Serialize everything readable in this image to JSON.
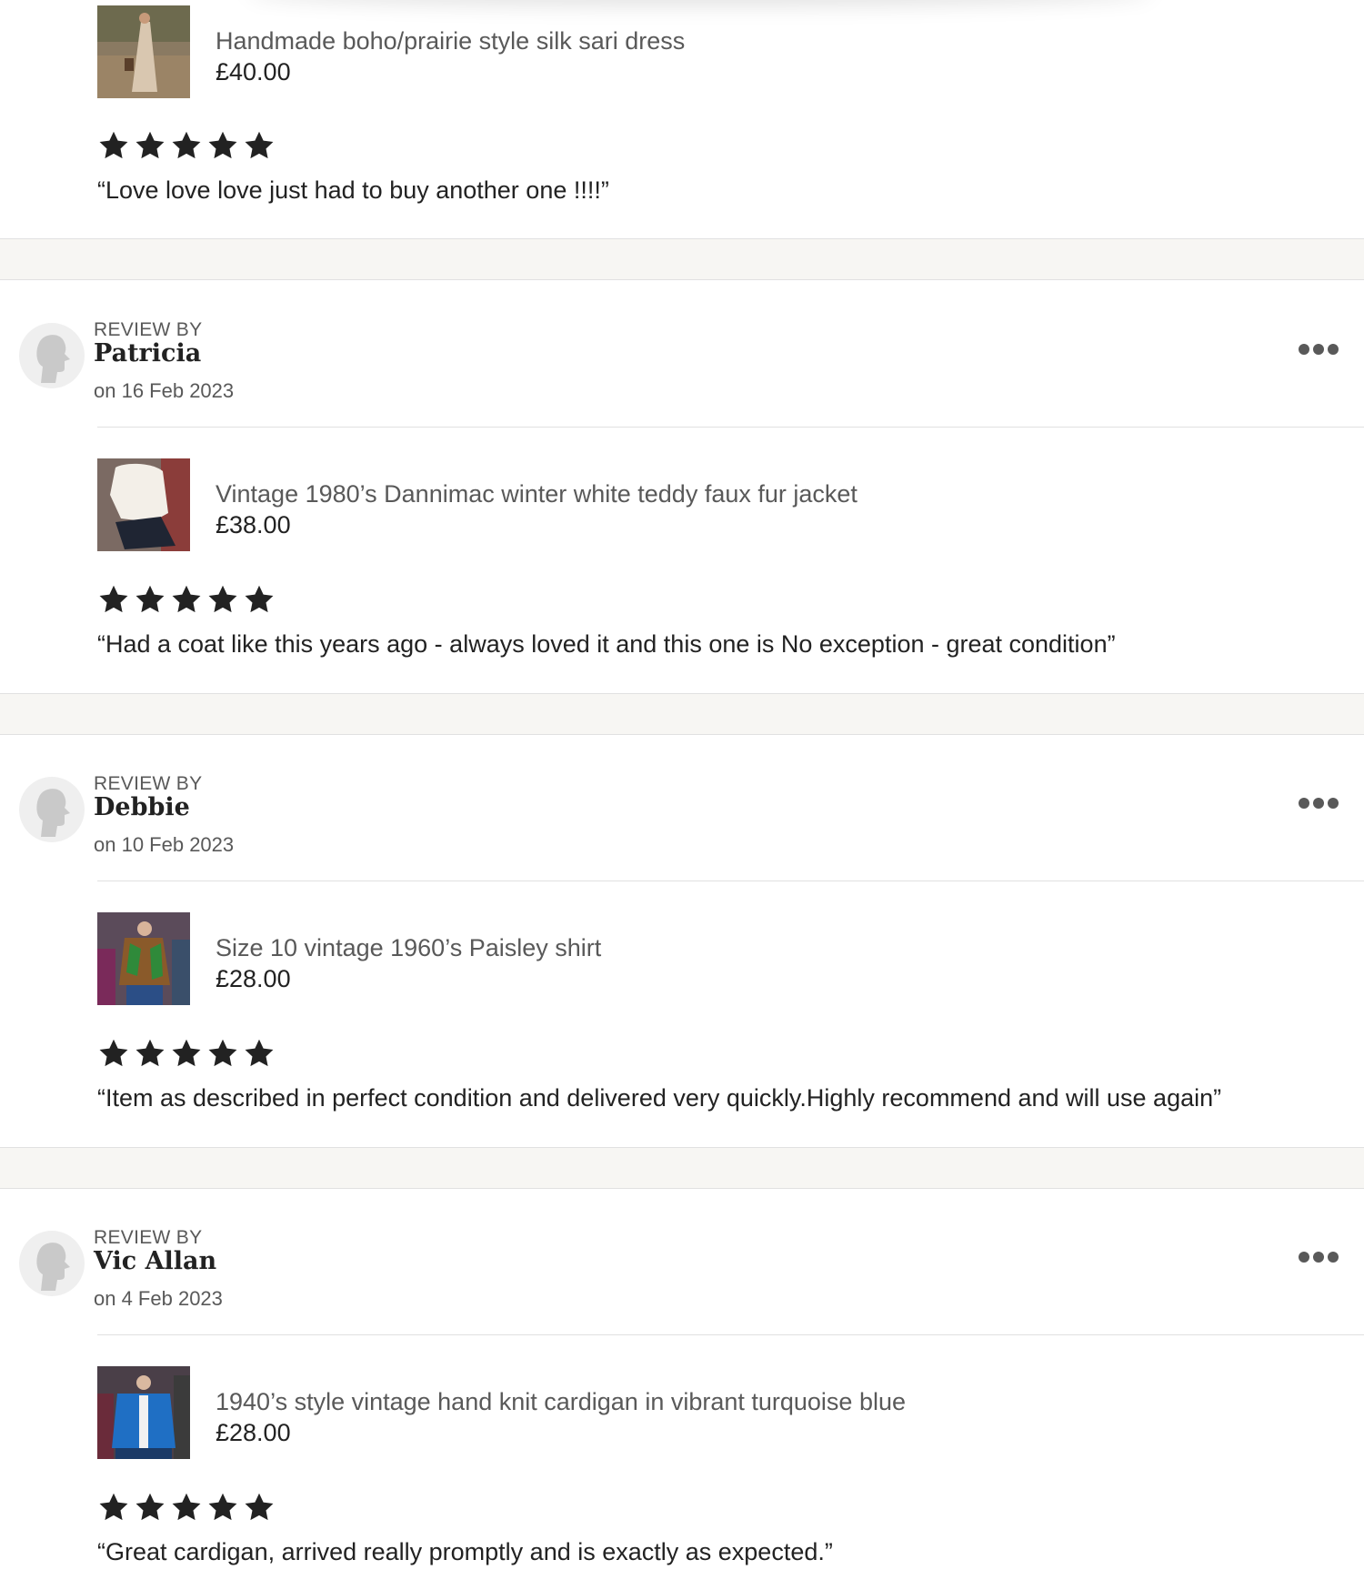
{
  "reviews": [
    {
      "review_by_label": "",
      "reviewer": "",
      "date": "",
      "product": {
        "title": "Handmade boho/prairie style silk sari dress",
        "price": "£40.00"
      },
      "rating": 5,
      "text": "“Love love love just had to buy another one !!!!”"
    },
    {
      "review_by_label": "REVIEW BY",
      "reviewer": "Patricia",
      "date": "on 16 Feb 2023",
      "product": {
        "title": "Vintage 1980’s Dannimac winter white teddy faux fur jacket",
        "price": "£38.00"
      },
      "rating": 5,
      "text": "“Had a coat like this years ago - always loved it and this one is No exception - great condition”"
    },
    {
      "review_by_label": "REVIEW BY",
      "reviewer": "Debbie",
      "date": "on 10 Feb 2023",
      "product": {
        "title": "Size 10 vintage 1960’s Paisley shirt",
        "price": "£28.00"
      },
      "rating": 5,
      "text": "“Item as described in perfect condition and delivered very quickly.Highly recommend and will use again”"
    },
    {
      "review_by_label": "REVIEW BY",
      "reviewer": "Vic Allan",
      "date": "on 4 Feb 2023",
      "product": {
        "title": "1940’s style vintage hand knit cardigan in vibrant turquoise blue",
        "price": "£28.00"
      },
      "rating": 5,
      "text": "“Great cardigan, arrived really promptly and is exactly as expected.”"
    }
  ],
  "icons": {
    "more": "more-options-icon",
    "star": "star-icon",
    "avatar": "default-avatar-icon"
  },
  "colors": {
    "text_primary": "#222222",
    "text_secondary": "#595959",
    "divider": "#e1e1e1",
    "band": "#f7f6f3"
  }
}
